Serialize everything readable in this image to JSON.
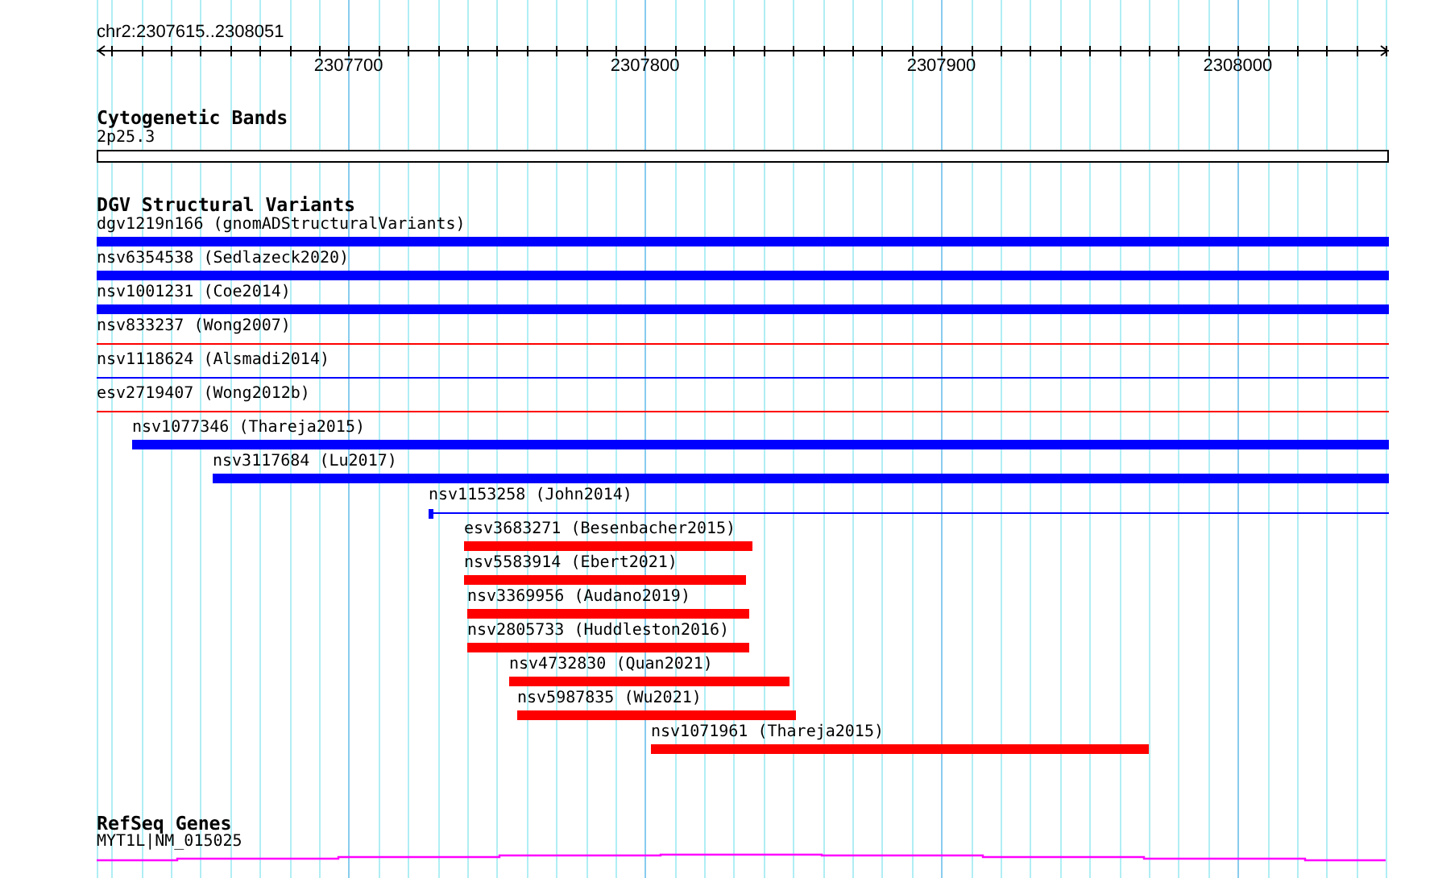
{
  "ruler": {
    "location": "chr2:2307615..2308051",
    "ticks": [
      {
        "label": "2307700"
      },
      {
        "label": "2307800"
      },
      {
        "label": "2307900"
      },
      {
        "label": "2308000"
      }
    ]
  },
  "tracks": [
    {
      "kind": "cytoband",
      "title": "Cytogenetic Bands",
      "bands": [
        {
          "label": "2p25.3"
        }
      ]
    },
    {
      "kind": "variants",
      "title": "DGV Structural Variants",
      "features": [
        {
          "label": "dgv1219n166 (gnomADStructuralVariants)",
          "kind": "thick",
          "color": "#0000ff"
        },
        {
          "label": "nsv6354538 (Sedlazeck2020)",
          "kind": "thick",
          "color": "#0000ff"
        },
        {
          "label": "nsv1001231 (Coe2014)",
          "kind": "thick",
          "color": "#0000ff"
        },
        {
          "label": "nsv833237 (Wong2007)",
          "kind": "thin",
          "color": "#ff0000"
        },
        {
          "label": "nsv1118624 (Alsmadi2014)",
          "kind": "thin",
          "color": "#0000ff"
        },
        {
          "label": "esv2719407 (Wong2012b)",
          "kind": "thin",
          "color": "#ff0000"
        },
        {
          "label": "nsv1077346 (Thareja2015)",
          "kind": "thick",
          "color": "#0000ff"
        },
        {
          "label": "nsv3117684 (Lu2017)",
          "kind": "thick",
          "color": "#0000ff"
        },
        {
          "label": "nsv1153258 (John2014)",
          "kind": "thin",
          "color": "#0000ff"
        },
        {
          "label": "esv3683271 (Besenbacher2015)",
          "kind": "thick",
          "color": "#ff0000"
        },
        {
          "label": "nsv5583914 (Ebert2021)",
          "kind": "thick",
          "color": "#ff0000"
        },
        {
          "label": "nsv3369956 (Audano2019)",
          "kind": "thick",
          "color": "#ff0000"
        },
        {
          "label": "nsv2805733 (Huddleston2016)",
          "kind": "thick",
          "color": "#ff0000"
        },
        {
          "label": "nsv4732830 (Quan2021)",
          "kind": "thick",
          "color": "#ff0000"
        },
        {
          "label": "nsv5987835 (Wu2021)",
          "kind": "thick",
          "color": "#ff0000"
        },
        {
          "label": "nsv1071961 (Thareja2015)",
          "kind": "thick",
          "color": "#ff0000"
        }
      ]
    },
    {
      "kind": "genes",
      "title": "RefSeq Genes",
      "genes": [
        {
          "label": "MYT1L|NM_015025"
        }
      ]
    }
  ]
}
